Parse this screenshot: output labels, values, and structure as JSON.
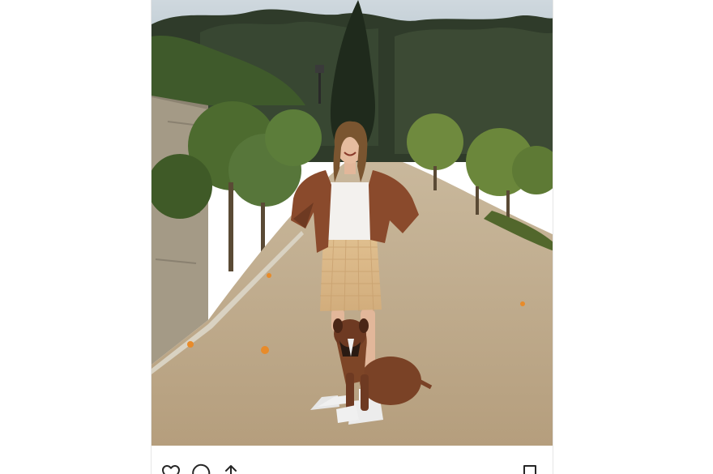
{
  "post": {
    "photo": {
      "alt": "",
      "scene": "garden-path"
    },
    "actions": {
      "like_icon": "heart-icon",
      "comment_icon": "comment-icon",
      "share_icon": "share-icon",
      "save_icon": "bookmark-icon"
    }
  },
  "colors": {
    "background": "#ffffff",
    "icon_stroke": "#262626",
    "card_border": "#e6e6e6"
  }
}
